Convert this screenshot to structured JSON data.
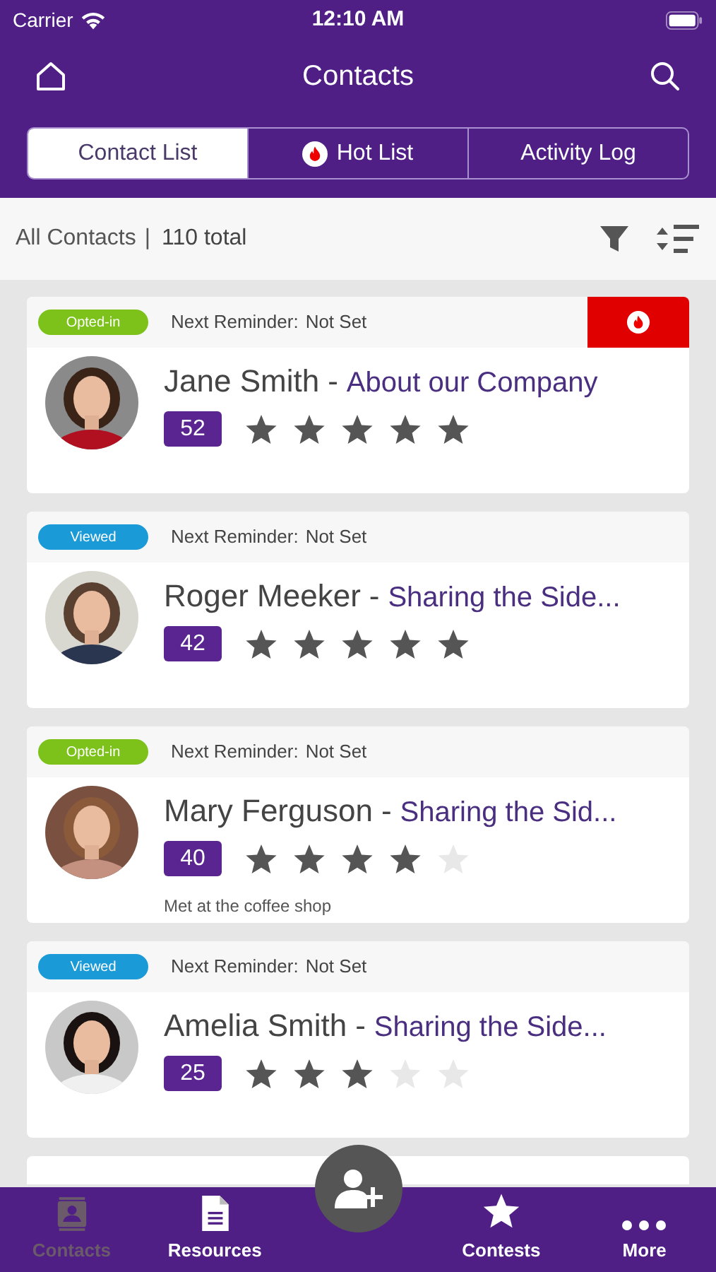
{
  "status_bar": {
    "carrier": "Carrier",
    "time": "12:10 AM"
  },
  "header": {
    "title": "Contacts"
  },
  "tabs": [
    {
      "label": "Contact List",
      "selected": true,
      "hot_icon": false
    },
    {
      "label": "Hot List",
      "selected": false,
      "hot_icon": true
    },
    {
      "label": "Activity Log",
      "selected": false,
      "hot_icon": false
    }
  ],
  "filter_bar": {
    "label": "All Contacts",
    "separator": "|",
    "total": "110 total"
  },
  "contacts": [
    {
      "status": "Opted-in",
      "color": "#7cc21b",
      "reminder_label": "Next Reminder:",
      "reminder": "Not Set",
      "hot": true,
      "name": "Jane Smith",
      "separator": "-",
      "topic": "About our Company",
      "score": "52",
      "stars": 5
    },
    {
      "status": "Viewed",
      "color": "#1a9ad6",
      "reminder_label": "Next Reminder:",
      "reminder": "Not Set",
      "hot": false,
      "name": "Roger Meeker",
      "separator": "-",
      "topic": "Sharing the Side...",
      "score": "42",
      "stars": 5
    },
    {
      "status": "Opted-in",
      "color": "#7cc21b",
      "reminder_label": "Next Reminder:",
      "reminder": "Not Set",
      "hot": false,
      "name": "Mary Ferguson",
      "separator": "-",
      "topic": "Sharing the Sid...",
      "score": "40",
      "stars": 4,
      "note": "Met at the coffee shop"
    },
    {
      "status": "Viewed",
      "color": "#1a9ad6",
      "reminder_label": "Next Reminder:",
      "reminder": "Not Set",
      "hot": false,
      "name": "Amelia Smith",
      "separator": "-",
      "topic": "Sharing the Side...",
      "score": "25",
      "stars": 3
    }
  ],
  "bottom_nav": [
    {
      "label": "Contacts",
      "kind": "contacts",
      "selected": true
    },
    {
      "label": "Resources",
      "kind": "resources",
      "selected": false
    },
    {
      "kind": "add"
    },
    {
      "label": "Contests",
      "kind": "contests",
      "selected": false
    },
    {
      "label": "More",
      "kind": "more",
      "selected": false
    }
  ]
}
